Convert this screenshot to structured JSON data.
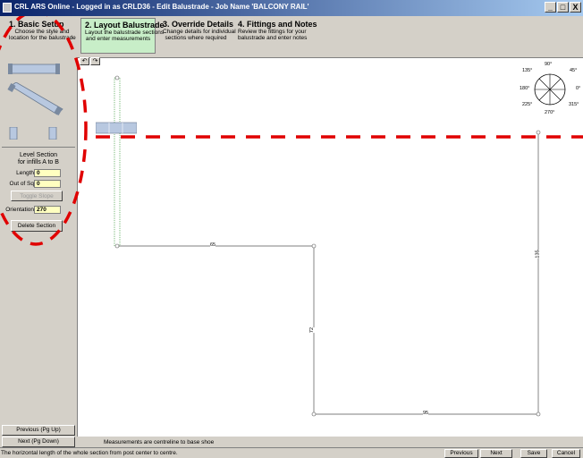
{
  "window": {
    "title": "CRL ARS Online - Logged in as CRLD36 - Edit Balustrade - Job Name 'BALCONY RAIL'",
    "minimize": "_",
    "maximize": "Ʌ",
    "close": "X"
  },
  "steps": [
    {
      "title": "1. Basic Setup",
      "desc1": "Choose the style and",
      "desc2": "location for the balustrade"
    },
    {
      "title": "2. Layout Balustrade",
      "desc1": "Layout the balustrade sections",
      "desc2": "and enter measurements"
    },
    {
      "title": "3. Override Details",
      "desc1": "Change details for individual",
      "desc2": "sections where required"
    },
    {
      "title": "4. Fittings and Notes",
      "desc1": "Review the fittings for your",
      "desc2": "balustrade and enter notes"
    }
  ],
  "left_panel": {
    "caption_line1": "Level Section",
    "caption_line2": "for infills A to B",
    "length_label": "Length",
    "length_value": "0",
    "out_of_sq_label": "Out of Sq",
    "out_of_sq_value": "0",
    "toggle_slope": "Toggle Slope",
    "orientation_label": "Orientation",
    "orientation_value": "270",
    "delete_section": "Delete Section"
  },
  "compass": {
    "d90": "90°",
    "d45": "45°",
    "d135": "135°",
    "d180": "180°",
    "d0": "0°",
    "d225": "225°",
    "d315": "315°",
    "d270": "270°"
  },
  "drawing": {
    "dim_top": "65",
    "dim_right": "135",
    "dim_middle": "72",
    "dim_bottom": "95"
  },
  "buttons": {
    "previous_pgup": "Previous (Pg Up)",
    "next_pgdown": "Next (Pg Down)",
    "previous": "Previous",
    "next": "Next",
    "save": "Save",
    "cancel": "Cancel"
  },
  "note": "Measurements are centreline to base shoe",
  "status": "The horizontal length of the whole section from post center to centre.",
  "colors": {
    "active_step": "#c8eec8",
    "input_bg": "#ffffc0",
    "annotation_red": "#e00000",
    "railing_blue": "#b8c8e0"
  }
}
